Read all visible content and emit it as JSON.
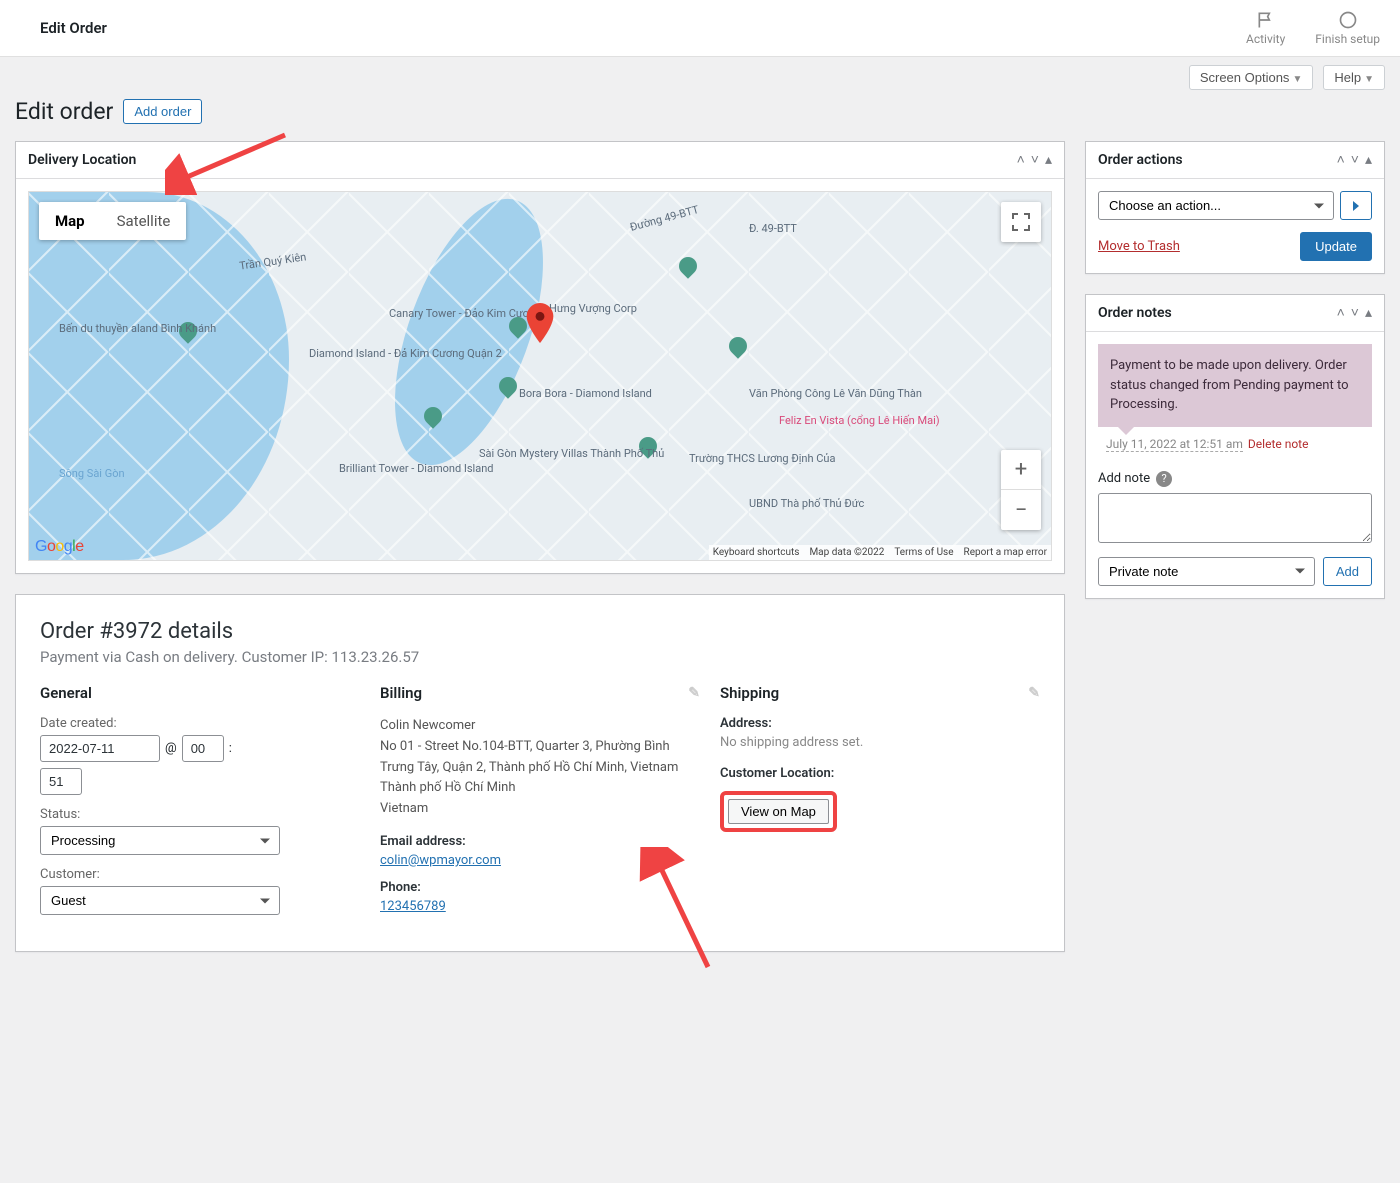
{
  "topbar": {
    "title": "Edit Order",
    "activity": "Activity",
    "finish_setup": "Finish setup"
  },
  "screen_meta": {
    "screen_options": "Screen Options",
    "help": "Help"
  },
  "page": {
    "title": "Edit order",
    "add_order": "Add order"
  },
  "delivery_location": {
    "title": "Delivery Location",
    "map_tab": "Map",
    "satellite_tab": "Satellite",
    "attrib": {
      "shortcuts": "Keyboard shortcuts",
      "data": "Map data ©2022",
      "terms": "Terms of Use",
      "report": "Report a map error"
    },
    "places": {
      "p1": "Bến du thuyền\naland Bình Khánh",
      "p2": "Diamond Island - Đả\nKim Cương Quận 2",
      "p3": "Hưng Vượng Corp",
      "p4": "Bora Bora -\nDiamond Island",
      "p5": "Brilliant Tower -\nDiamond Island",
      "p6": "Sài Gòn Mystery\nVillas Thành Phố Thủ",
      "p7": "Trường THCS\nLương Định Của",
      "p8": "Văn Phòng Công\nLê Văn Dũng Thàn",
      "p9": "UBND Thà\nphố Thủ Đức",
      "p10": "Trần Quý Kiên",
      "p11": "Đường 49-BTT",
      "p12": "Đ. 49-BTT",
      "p13": "Sông Sài Gòn",
      "hot": "Feliz En Vista\n(cổng Lê Hiến Mai)",
      "canary": "Canary Tower -\nĐảo Kim Cương"
    }
  },
  "order_details": {
    "title": "Order #3972 details",
    "subtitle": "Payment via Cash on delivery. Customer IP: 113.23.26.57",
    "general": {
      "heading": "General",
      "date_created_label": "Date created:",
      "date": "2022-07-11",
      "at": "@",
      "hour": "00",
      "colon": ":",
      "minute": "51",
      "status_label": "Status:",
      "status": "Processing",
      "customer_label": "Customer:",
      "customer": "Guest"
    },
    "billing": {
      "heading": "Billing",
      "name": "Colin Newcomer",
      "address": "No 01 - Street No.104-BTT, Quarter 3, Phường Bình Trưng Tây, Quận 2, Thành phố Hồ Chí Minh, Vietnam\nThành phố Hồ Chí Minh\nVietnam",
      "email_label": "Email address:",
      "email": "colin@wpmayor.com",
      "phone_label": "Phone:",
      "phone": "123456789"
    },
    "shipping": {
      "heading": "Shipping",
      "address_label": "Address:",
      "no_address": "No shipping address set.",
      "customer_location_label": "Customer Location:",
      "view_on_map": "View on Map"
    }
  },
  "order_actions": {
    "title": "Order actions",
    "choose": "Choose an action...",
    "trash": "Move to Trash",
    "update": "Update"
  },
  "order_notes": {
    "title": "Order notes",
    "note_text": "Payment to be made upon delivery. Order status changed from Pending payment to Processing.",
    "meta_date": "July 11, 2022 at 12:51 am",
    "delete": "Delete note",
    "add_label": "Add note",
    "note_type": "Private note",
    "add_btn": "Add"
  }
}
